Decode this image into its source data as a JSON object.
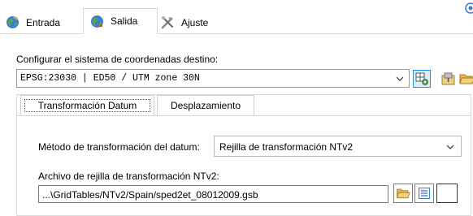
{
  "main_tabs": [
    {
      "label": "Entrada",
      "icon": "globe-arrow-icon",
      "active": false
    },
    {
      "label": "Salida",
      "icon": "globe-arrow-icon",
      "active": true
    },
    {
      "label": "Ajuste",
      "icon": "tools-icon",
      "active": false
    }
  ],
  "output_crs": {
    "label": "Configurar el sistema de coordenadas destino:",
    "value": "EPSG:23030 | ED50 / UTM zone 30N"
  },
  "sub_tabs": [
    {
      "label": "Transformación Datum",
      "active": true
    },
    {
      "label": "Desplazamiento",
      "active": false
    }
  ],
  "datum": {
    "method_label": "Método de transformación del datum:",
    "method_value": "Rejilla de transformación NTv2",
    "grid_label": "Archivo de rejilla de transformación NTv2:",
    "grid_value": "...\\GridTables/NTv2/Spain/sped2et_08012009.gsb"
  },
  "colors": {
    "border": "#d9d9d9",
    "focus_blue": "#2a8fd8",
    "folder_yellow": "#e8b84a"
  }
}
